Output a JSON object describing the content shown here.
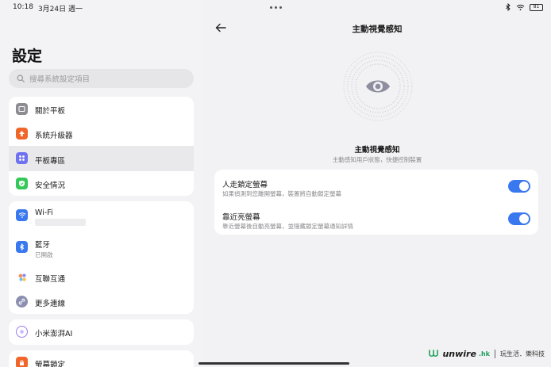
{
  "status": {
    "time": "10:18",
    "date": "3月24日 週一",
    "battery": "81"
  },
  "sidebar": {
    "title": "設定",
    "search_placeholder": "搜尋系統設定項目",
    "group1": [
      {
        "label": "關於平板",
        "icon": "tablet-icon"
      },
      {
        "label": "系統升級器",
        "icon": "upgrade-arrow-icon"
      },
      {
        "label": "平板專區",
        "icon": "grid-icon"
      },
      {
        "label": "安全情況",
        "icon": "shield-check-icon"
      }
    ],
    "group2": [
      {
        "label": "Wi-Fi",
        "icon": "wifi-icon"
      },
      {
        "label": "藍牙",
        "sub": "已開啟",
        "icon": "bluetooth-icon"
      },
      {
        "label": "互聯互通",
        "icon": "interconnect-icon"
      },
      {
        "label": "更多連線",
        "icon": "link-icon"
      }
    ],
    "group3": [
      {
        "label": "小米澎湃AI",
        "icon": "ai-icon"
      }
    ],
    "group4": [
      {
        "label": "螢幕鎖定",
        "icon": "lock-icon"
      }
    ]
  },
  "detail": {
    "title": "主動視覺感知",
    "feature_title": "主動視覺感知",
    "feature_desc": "主動感知用戶狀態，快捷控制裝置",
    "toggles": [
      {
        "title": "人走鎖定螢幕",
        "desc": "如果偵測到您離開螢幕，裝置將自動鎖定螢幕",
        "on": true
      },
      {
        "title": "靠近亮螢幕",
        "desc": "靠近螢幕後自動亮螢幕，並隱藏鎖定螢幕通知詳情",
        "on": true
      }
    ]
  },
  "watermark": {
    "brand": "unwire",
    "suffix": ".hk",
    "tagline": "玩生活．樂科技"
  },
  "colors": {
    "accent": "#3a78f0",
    "upgrade": "#f0662a",
    "grid": "#6f72f0",
    "shield": "#34c759",
    "bluetooth": "#3a78f0"
  }
}
